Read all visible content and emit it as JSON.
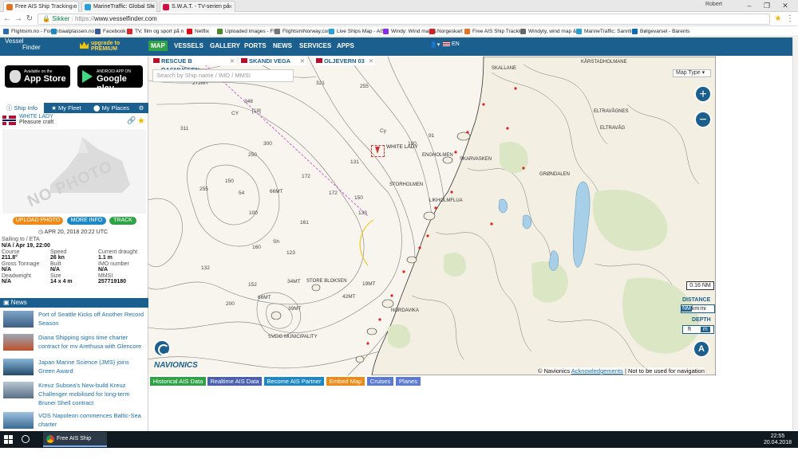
{
  "browser": {
    "tabs": [
      {
        "title": "Free AIS Ship Tracking o",
        "color": "#e37222"
      },
      {
        "title": "MarineTraffic: Global Shi",
        "color": "#2a9fd6"
      },
      {
        "title": "S.W.A.T. - TV-serien på",
        "color": "#d0103a"
      }
    ],
    "user": "Robert",
    "secure_label": "Sikker",
    "url_proto": "https://",
    "url_host": "www.vesselfinder.com",
    "bookmarks": [
      {
        "label": "Flightsim.no - Forum",
        "color": "#2b6cb0"
      },
      {
        "label": "baatplassen.no",
        "color": "#1e88c7"
      },
      {
        "label": "Facebook",
        "color": "#3b5998"
      },
      {
        "label": "TV, film og sport på n",
        "color": "#d62b2b"
      },
      {
        "label": "Netflix",
        "color": "#e50914"
      },
      {
        "label": "Uploaded images - Fli",
        "color": "#4a8a2a"
      },
      {
        "label": "FlightsimNorway.com",
        "color": "#777777"
      },
      {
        "label": "Live Ships Map - AIS",
        "color": "#2a9fd6"
      },
      {
        "label": "Windy: Wind map &",
        "color": "#8a2be2"
      },
      {
        "label": "Norgeskart",
        "color": "#cc2222"
      },
      {
        "label": "Free AIS Ship Trackin",
        "color": "#e37222"
      },
      {
        "label": "Windyty, wind map &",
        "color": "#666666"
      },
      {
        "label": "MarineTraffic: Sanntid",
        "color": "#2a9fd6"
      },
      {
        "label": "Bølgevarsel - Barents",
        "color": "#0a6ab5"
      }
    ]
  },
  "site": {
    "logo_line1": "Vessel",
    "logo_line2": "Finder",
    "premium_line1": "upgrade to",
    "premium_line2": "PREMIUM",
    "nav": [
      "MAP",
      "VESSELS",
      "GALLERY",
      "PORTS",
      "NEWS",
      "SERVICES",
      "APPS"
    ],
    "lang": "EN"
  },
  "stores": {
    "apple_top": "Available on the",
    "apple_main": "App Store",
    "google_top": "ANDROID APP ON",
    "google_main": "Google play"
  },
  "panel": {
    "tabs": [
      "Ship Info",
      "My Fleet",
      "My Places"
    ],
    "ship_name": "WHITE LADY",
    "ship_type": "Pleasure craft",
    "no_photo": "NO PHOTO",
    "buttons": [
      {
        "label": "UPLOAD PHOTO",
        "color": "#ef8a17"
      },
      {
        "label": "MORE INFO",
        "color": "#1e88c7"
      },
      {
        "label": "TRACK",
        "color": "#2ea244"
      }
    ],
    "timestamp": "APR 20, 2018 20:22 UTC",
    "sailing_label": "Sailing to / ETA",
    "sailing_value": "N/A / Apr 19, 22:00",
    "fields": [
      {
        "k": "Course",
        "v": "211.8°"
      },
      {
        "k": "Speed",
        "v": "26 kn"
      },
      {
        "k": "Current draught",
        "v": "1.1 m"
      },
      {
        "k": "Gross Tonnage",
        "v": "N/A"
      },
      {
        "k": "Built",
        "v": "N/A"
      },
      {
        "k": "IMO number",
        "v": "N/A"
      },
      {
        "k": "Deadweight",
        "v": "N/A"
      },
      {
        "k": "Size",
        "v": "14 x 4 m"
      },
      {
        "k": "MMSI",
        "v": "257719180"
      }
    ]
  },
  "news": {
    "title": "News",
    "items": [
      "Port of Seattle Kicks off Another Record Season",
      "Diana Shipping signs time charter contract for mv Arethusa with Glencore",
      "Japan Marine Science (JMS) joins Green Award",
      "Kreuz Subsea's New-build Kreuz Challenger mobilised for long-term Brunei Shell contract",
      "VOS Napoleon commences Baltic-Sea charter"
    ]
  },
  "map": {
    "ship_tabs": [
      "RESCUE B RASMUSSEN",
      "SKANDI VEGA",
      "OLJEVERN 03"
    ],
    "search_placeholder": "Search by Ship name / IMO / MMSI",
    "map_type": "Map Type",
    "scale": "0.16 NM",
    "distance_label": "DISTANCE",
    "distance_units": [
      "NM",
      "km",
      "mi"
    ],
    "depth_label": "DEPTH",
    "depth_units": [
      "ft",
      "m"
    ],
    "compass": "A",
    "brand": "NAVIONICS",
    "credit_prefix": "© Navionics",
    "credit_link": "Acknowledgements",
    "credit_suffix": "| Not to be used for navigation",
    "ship_label": "WHITE LADY",
    "place_labels": [
      "KÅRSTADHOLMANE",
      "SKALLANE",
      "ELTRAVÅGNES",
      "ELTRAVÅG",
      "GRØNDALEN",
      "STORHOLMEN",
      "LIKHOLMFLUA",
      "ENGHOLMEN",
      "SKARVASKEN",
      "STORE BLOKSEN",
      "NORDAVIKA",
      "SVEIG MUNICIPALITY"
    ],
    "depths": [
      "272MT",
      "321",
      "255",
      "348",
      "311",
      "CY",
      "[19]",
      "300",
      "131",
      "250",
      "255",
      "150",
      "54",
      "66MT",
      "172",
      "172",
      "100",
      "150",
      "161",
      "160",
      "123",
      "132",
      "152",
      "200",
      "66MT",
      "39MT",
      "Sh",
      "Cy",
      "133",
      "91",
      "100",
      "42MT",
      "34MT",
      "19MT"
    ]
  },
  "bottom_buttons": [
    {
      "label": "Historical AIS Data",
      "color": "#2ea244"
    },
    {
      "label": "Realtime AIS Data",
      "color": "#4b5fb2"
    },
    {
      "label": "Become AIS Partner",
      "color": "#1e88c7"
    },
    {
      "label": "Embed Map",
      "color": "#ef8a17"
    },
    {
      "label": "Cruises",
      "color": "#5b7bd5"
    },
    {
      "label": "Planes",
      "color": "#5b7bd5"
    }
  ],
  "taskbar": {
    "app": "Free AIS Ship Tracki...",
    "time": "22:55",
    "date": "20.04.2018"
  }
}
